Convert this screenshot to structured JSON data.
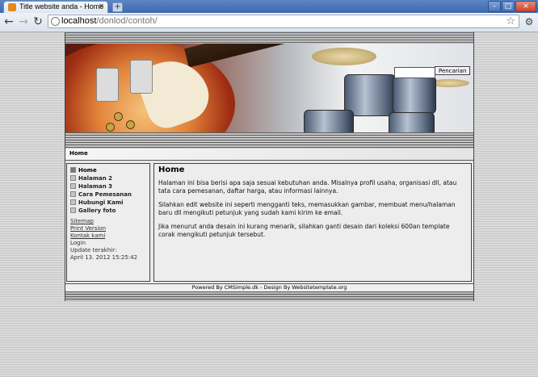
{
  "browser": {
    "tab_title": "Title website anda - Home",
    "tab_close": "×",
    "new_tab": "+",
    "url_host": "localhost",
    "url_path": "/donlod/contoh/"
  },
  "header": {
    "search_placeholder": "",
    "search_button": "Pencarian"
  },
  "breadcrumb": "Home",
  "menu": {
    "items": [
      {
        "label": "Home"
      },
      {
        "label": "Halaman 2"
      },
      {
        "label": "Halaman 3"
      },
      {
        "label": "Cara Pemesanan"
      },
      {
        "label": "Hubungi Kami"
      },
      {
        "label": "Gallery foto"
      }
    ]
  },
  "sidebar": {
    "sitemap": "Sitemap",
    "print_version": "Print Version",
    "contact": "Kontak kami",
    "login": "Login",
    "update_label": "Update terakhir:",
    "update_date": "April 13. 2012 15:25:42"
  },
  "content": {
    "title": "Home",
    "paragraphs": [
      "Halaman ini bisa berisi apa saja sesuai kebutuhan anda. Misalnya profil usaha, organisasi dll, atau tata cara pemesanan, daftar harga, atau informasi lainnya.",
      "Silahkan edit website ini seperti mengganti teks, memasukkan gambar, membuat menu/halaman baru dll mengikuti petunjuk yang sudah kami kirim ke email.",
      "Jika menurut anda desain ini kurang menarik, silahkan ganti desain dari koleksi 600an template corak mengikuti petunjuk tersebut."
    ]
  },
  "footer": "Powered By CMSimple.dk - Design By Websitetemplate.org"
}
